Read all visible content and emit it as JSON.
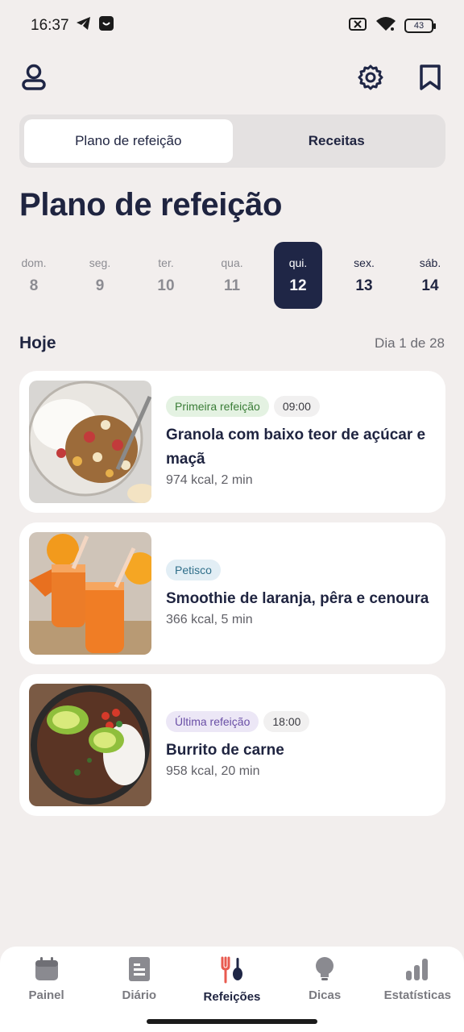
{
  "status_bar": {
    "time": "16:37",
    "battery": "43"
  },
  "tabs": [
    {
      "label": "Plano de refeição",
      "active": true
    },
    {
      "label": "Receitas",
      "active": false
    }
  ],
  "page_title": "Plano de refeição",
  "days": [
    {
      "name": "dom.",
      "num": "8",
      "state": "past"
    },
    {
      "name": "seg.",
      "num": "9",
      "state": "past"
    },
    {
      "name": "ter.",
      "num": "10",
      "state": "past"
    },
    {
      "name": "qua.",
      "num": "11",
      "state": "past"
    },
    {
      "name": "qui.",
      "num": "12",
      "state": "selected"
    },
    {
      "name": "sex.",
      "num": "13",
      "state": "future"
    },
    {
      "name": "sáb.",
      "num": "14",
      "state": "future"
    }
  ],
  "today": {
    "label": "Hoje",
    "day_count": "Dia 1 de 28"
  },
  "meals": [
    {
      "tag": "Primeira refeição",
      "tag_color": "green",
      "time": "09:00",
      "name": "Granola com baixo teor de açúcar e maçã",
      "info": "974 kcal, 2 min"
    },
    {
      "tag": "Petisco",
      "tag_color": "blue",
      "time": "",
      "name": "Smoothie de laranja, pêra e cenoura",
      "info": "366 kcal, 5 min"
    },
    {
      "tag": "Última refeição",
      "tag_color": "purple",
      "time": "18:00",
      "name": "Burrito de carne",
      "info": "958 kcal, 20 min"
    }
  ],
  "nav": [
    {
      "label": "Painel",
      "icon": "calendar-icon",
      "active": false
    },
    {
      "label": "Diário",
      "icon": "document-icon",
      "active": false
    },
    {
      "label": "Refeições",
      "icon": "fork-spoon-icon",
      "active": true
    },
    {
      "label": "Dicas",
      "icon": "lightbulb-icon",
      "active": false
    },
    {
      "label": "Estatísticas",
      "icon": "bar-chart-icon",
      "active": false
    }
  ],
  "colors": {
    "background": "#f2eeed",
    "primary_dark": "#1f2646",
    "accent_red": "#e85a4f"
  }
}
